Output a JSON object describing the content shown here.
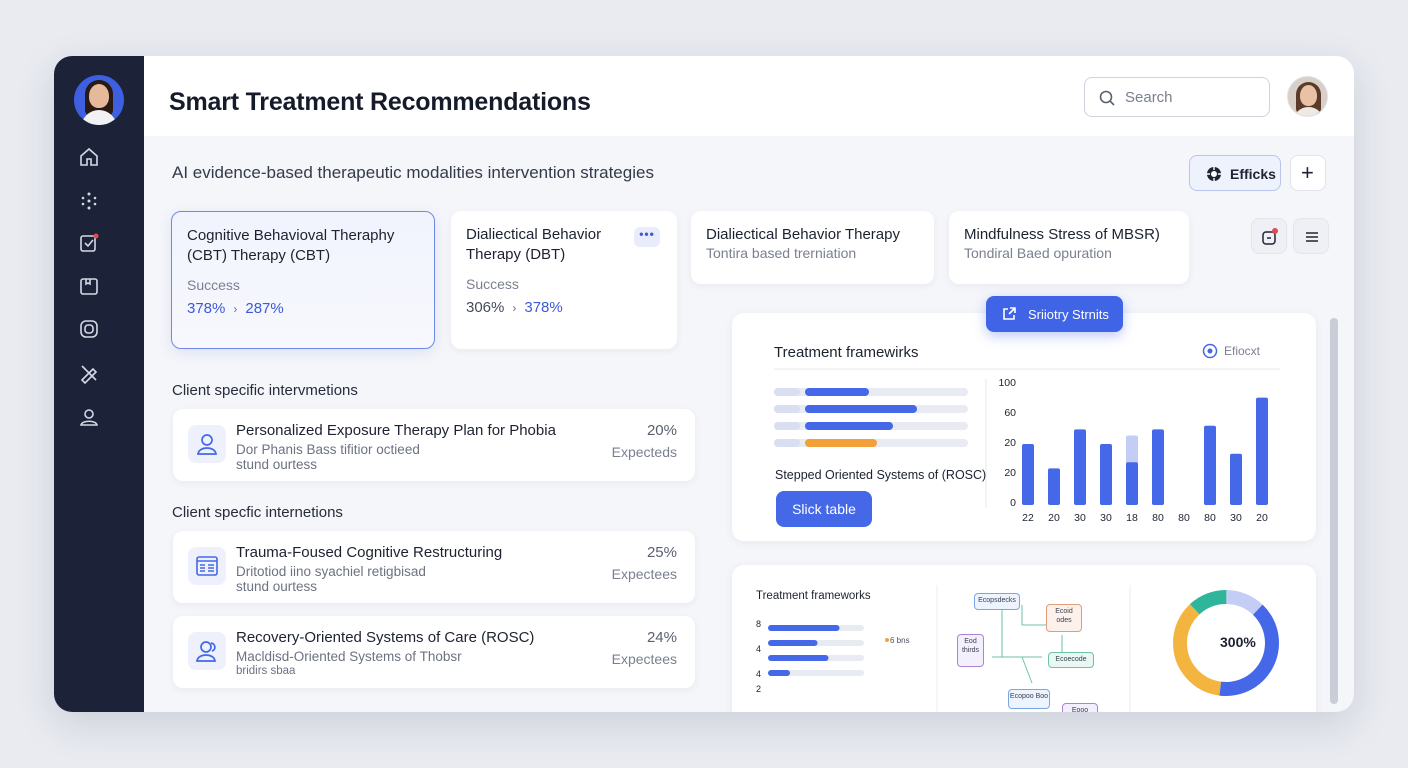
{
  "header": {
    "title": "Smart Treatment Recommendations",
    "search_placeholder": "Search"
  },
  "subtitle": "AI evidence-based therapeutic modalities intervention strategies",
  "actions": {
    "effects_label": "Efficks",
    "add_label": "+"
  },
  "therapy_cards": [
    {
      "title": "Cognitive Behavioval Theraphy (CBT) Therapy (CBT)",
      "sub_label": "Success",
      "from": "378%",
      "to": "287%"
    },
    {
      "title": "Dialiectical Behavior Therapy (DBT)",
      "sub_label": "Success",
      "from": "306%",
      "to": "378%",
      "menu": "•••"
    },
    {
      "title": "Dialiectical Behavior Therapy",
      "subtitle": "Tontira based trerniation"
    },
    {
      "title": "Mindfulness Stress of MBSR)",
      "subtitle": "Tondiral Baed opuration"
    }
  ],
  "sections": [
    "Client specific intervmetions",
    "Client specfic internetions"
  ],
  "interventions": [
    {
      "title": "Personalized Exposure Therapy Plan for Phobia",
      "line1": "Dor Phanis Bass tifitior octieed",
      "line2": "stund ourtess",
      "pct": "20%",
      "status": "Expecteds",
      "icon": "user-icon"
    },
    {
      "title": "Trauma-Foused Cognitive Restructuring",
      "line1": "Dritotiod iino syachiel retigbisad",
      "line2": "stund ourtess",
      "pct": "25%",
      "status": "Expectees",
      "icon": "document-icon"
    },
    {
      "title": "Recovery-Oriented Systems of Care (ROSC)",
      "line1": "Macldisd-Oriented Systems of Thobsr",
      "line2": "bridirs sbaa",
      "pct": "24%",
      "status": "Expectees",
      "icon": "users-icon"
    }
  ],
  "floating_button": "Sriiotry Strnits",
  "frameworks_panel": {
    "title": "Treatment framewirks",
    "legend": "Efiocxt",
    "caption": "Stepped Oriented Systems of (ROSC)",
    "button": "Slick table",
    "bars": [
      0.4,
      0.7,
      0.55,
      0.45
    ],
    "bar_colors": [
      "#4468e8",
      "#4468e8",
      "#4468e8",
      "#f4a03a"
    ]
  },
  "chart_data": [
    {
      "type": "bar",
      "title": "",
      "y_ticks": [
        "100",
        "60",
        "20",
        "20",
        "0"
      ],
      "categories": [
        "22",
        "20",
        "30",
        "30",
        "18",
        "80",
        "80",
        "80",
        "30",
        "20"
      ],
      "series": [
        {
          "values": [
            50,
            30,
            62,
            50,
            35,
            62,
            0,
            65,
            42,
            88
          ]
        },
        {
          "values": [
            0,
            0,
            0,
            48,
            57,
            51,
            0,
            65,
            0,
            0
          ]
        }
      ],
      "colors": [
        "#4468e8",
        "#c4cdf6"
      ]
    },
    {
      "type": "bar",
      "title": "Treatment frameworks",
      "y_ticks": [
        "8",
        "4",
        "4",
        "2"
      ],
      "values": [
        0.65,
        0.45,
        0.55,
        0.2
      ],
      "legend": "6 bns"
    },
    {
      "type": "pie",
      "label": "300%",
      "slices": [
        {
          "value": 12,
          "color": "#c4cdf6"
        },
        {
          "value": 40,
          "color": "#4468e8"
        },
        {
          "value": 36,
          "color": "#f4b540"
        },
        {
          "value": 12,
          "color": "#2fb59a"
        }
      ]
    }
  ],
  "flow_nodes": [
    {
      "label": "Ecopsdecks",
      "color": "#7aa6e8",
      "bg": "#eef4fd"
    },
    {
      "label": "Ecoid odes",
      "color": "#e39b7a",
      "bg": "#fdf1ec"
    },
    {
      "label": "Eod thirds",
      "color": "#a884d8",
      "bg": "#f4effc"
    },
    {
      "label": "Ecoecode",
      "color": "#6ec2a8",
      "bg": "#eaf8f3"
    },
    {
      "label": "Ecopoo Boo",
      "color": "#7aa6e8",
      "bg": "#eef4fd"
    },
    {
      "label": "Eooo",
      "color": "#a884d8",
      "bg": "#f4effc"
    }
  ]
}
